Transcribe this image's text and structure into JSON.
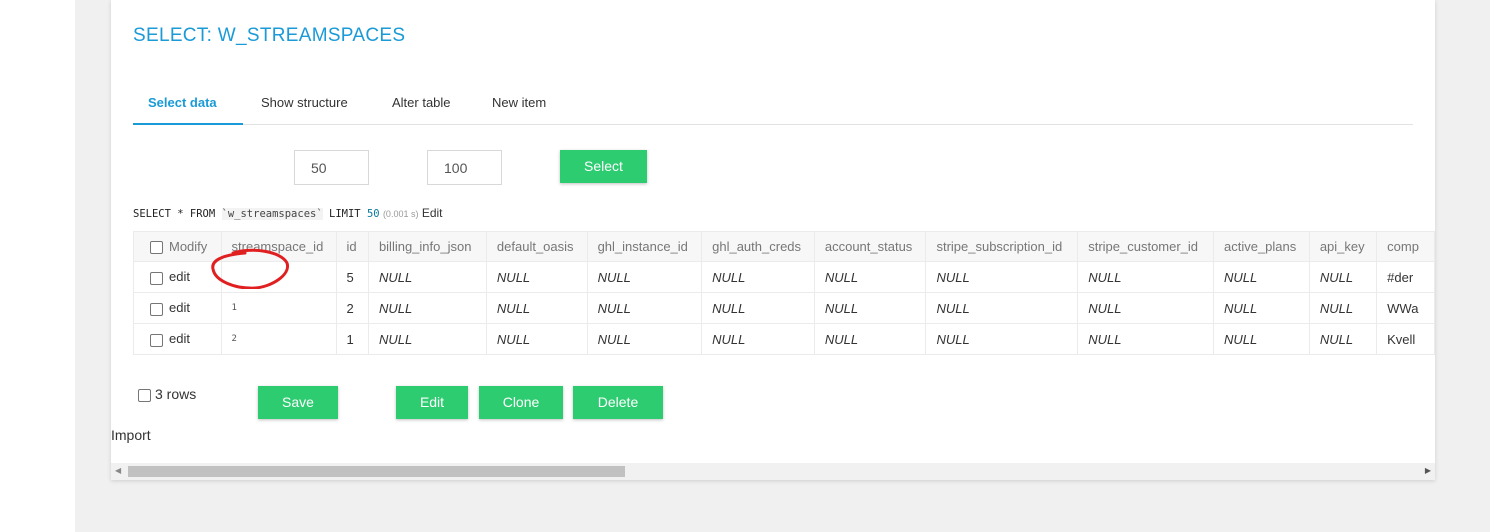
{
  "page": {
    "title": "SELECT: W_STREAMSPACES"
  },
  "tabs": [
    {
      "label": "Select data",
      "active": true
    },
    {
      "label": "Show structure",
      "active": false
    },
    {
      "label": "Alter table",
      "active": false
    },
    {
      "label": "New item",
      "active": false
    }
  ],
  "limits": {
    "limit_value": "50",
    "text_length_value": "100",
    "select_label": "Select"
  },
  "query": {
    "select_from": "SELECT * FROM",
    "table_name": "`w_streamspaces`",
    "limit_kw": "LIMIT",
    "limit_num": "50",
    "time": "(0.001 s)",
    "edit_label": "Edit"
  },
  "table": {
    "columns": [
      "Modify",
      "streamspace_id",
      "id",
      "billing_info_json",
      "default_oasis",
      "ghl_instance_id",
      "ghl_auth_creds",
      "account_status",
      "stripe_subscription_id",
      "stripe_customer_id",
      "active_plans",
      "api_key",
      "comp"
    ],
    "rows": [
      {
        "modify": "edit",
        "streamspace_id": "",
        "id": "5",
        "billing_info_json": "NULL",
        "default_oasis": "NULL",
        "ghl_instance_id": "NULL",
        "ghl_auth_creds": "NULL",
        "account_status": "NULL",
        "stripe_subscription_id": "NULL",
        "stripe_customer_id": "NULL",
        "active_plans": "NULL",
        "api_key": "NULL",
        "comp": "#der"
      },
      {
        "modify": "edit",
        "streamspace_id": "1",
        "id": "2",
        "billing_info_json": "NULL",
        "default_oasis": "NULL",
        "ghl_instance_id": "NULL",
        "ghl_auth_creds": "NULL",
        "account_status": "NULL",
        "stripe_subscription_id": "NULL",
        "stripe_customer_id": "NULL",
        "active_plans": "NULL",
        "api_key": "NULL",
        "comp": "WWa"
      },
      {
        "modify": "edit",
        "streamspace_id": "2",
        "id": "1",
        "billing_info_json": "NULL",
        "default_oasis": "NULL",
        "ghl_instance_id": "NULL",
        "ghl_auth_creds": "NULL",
        "account_status": "NULL",
        "stripe_subscription_id": "NULL",
        "stripe_customer_id": "NULL",
        "active_plans": "NULL",
        "api_key": "NULL",
        "comp": "Kvell"
      }
    ]
  },
  "footer": {
    "rows_label": "3 rows",
    "save_label": "Save",
    "edit_label": "Edit",
    "clone_label": "Clone",
    "delete_label": "Delete",
    "import_label": "Import"
  },
  "colors": {
    "accent": "#1a9ad6",
    "button_green": "#2ecc71",
    "annotation_red": "#e02020"
  }
}
